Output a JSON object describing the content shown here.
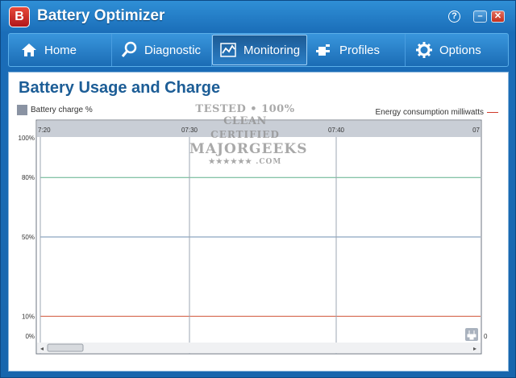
{
  "app": {
    "logo_letter": "B",
    "title": "Battery Optimizer",
    "help_label": "?",
    "minimize_label": "–",
    "close_label": "✕"
  },
  "nav": {
    "items": [
      {
        "label": "Home",
        "icon": "home-icon"
      },
      {
        "label": "Diagnostic",
        "icon": "magnifier-icon"
      },
      {
        "label": "Monitoring",
        "icon": "chart-icon",
        "active": true
      },
      {
        "label": "Profiles",
        "icon": "plug-icon"
      },
      {
        "label": "Options",
        "icon": "gear-icon"
      }
    ]
  },
  "page": {
    "title": "Battery Usage and Charge",
    "legend_left": "Battery charge %",
    "legend_right": "Energy consumption milliwatts"
  },
  "watermark": {
    "line1": "TESTED • 100% CLEAN",
    "line2": "CERTIFIED",
    "line3": "MAJORGEEKS",
    "line4": "★★★★★★ .COM"
  },
  "chart_data": {
    "type": "line",
    "x_ticks": [
      "7:20",
      "07:30",
      "07:40",
      "07"
    ],
    "y_ticks": [
      "100%",
      "80%",
      "50%",
      "10%",
      "0%"
    ],
    "y_values": [
      100,
      80,
      50,
      10,
      0
    ],
    "right_axis_ticks": [
      "0"
    ],
    "series": [],
    "grid": true,
    "colors": {
      "gridline": "#9ea7b3",
      "line80": "#5fb08a",
      "line50": "#6f8fb0",
      "line10": "#d0553a"
    }
  }
}
